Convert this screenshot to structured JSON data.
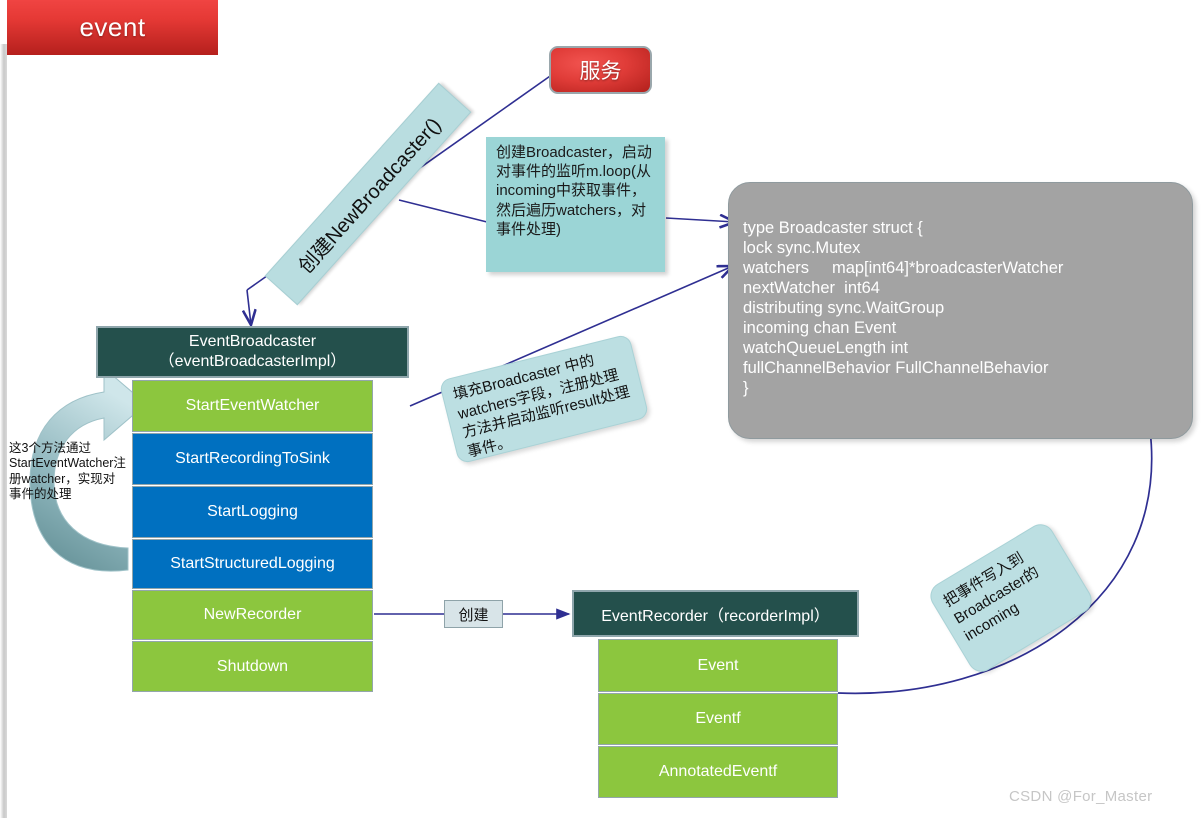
{
  "title_banner": {
    "label": "event"
  },
  "service_box": {
    "label": "服务"
  },
  "create_banner": {
    "label": "创建NewBroadcaster()"
  },
  "notes": {
    "loop": "创建Broadcaster，启动对事件的监听m.loop(从incoming中获取事件，然后遍历watchers，对事件处理)",
    "fill": "填充Broadcaster 中的watchers字段，注册处理方法并启动监听result处理事件。",
    "write": "把事件写入到Broadcaster的incoming"
  },
  "left_caption": "这3个方法通过StartEventWatcher注册watcher，实现对事件的处理",
  "create_label": "创建",
  "code_panel": {
    "lines": [
      "type Broadcaster struct {",
      "lock sync.Mutex",
      "watchers     map[int64]*broadcasterWatcher",
      "nextWatcher  int64",
      "distributing sync.WaitGroup",
      "incoming chan Event",
      "watchQueueLength int",
      "fullChannelBehavior FullChannelBehavior",
      "}"
    ]
  },
  "event_broadcaster": {
    "header_line1": "EventBroadcaster",
    "header_line2": "（eventBroadcasterImpl）",
    "methods": [
      {
        "label": "StartEventWatcher",
        "color": "green"
      },
      {
        "label": "StartRecordingToSink",
        "color": "blue"
      },
      {
        "label": "StartLogging",
        "color": "blue"
      },
      {
        "label": "StartStructuredLogging",
        "color": "blue"
      },
      {
        "label": "NewRecorder",
        "color": "green"
      },
      {
        "label": "Shutdown",
        "color": "green"
      }
    ]
  },
  "event_recorder": {
    "header": "EventRecorder（recorderImpl）",
    "methods": [
      {
        "label": "Event",
        "color": "green"
      },
      {
        "label": "Eventf",
        "color": "green"
      },
      {
        "label": "AnnotatedEventf",
        "color": "green"
      }
    ]
  },
  "watermark": "CSDN @For_Master",
  "colors": {
    "green": "#8cc63e",
    "blue": "#0070c0",
    "header_dark": "#24504c",
    "panel_gray": "#a3a3a3",
    "note_teal": "#9bd5d6",
    "banner_red": "#e53935",
    "connector": "#2f2f92"
  }
}
